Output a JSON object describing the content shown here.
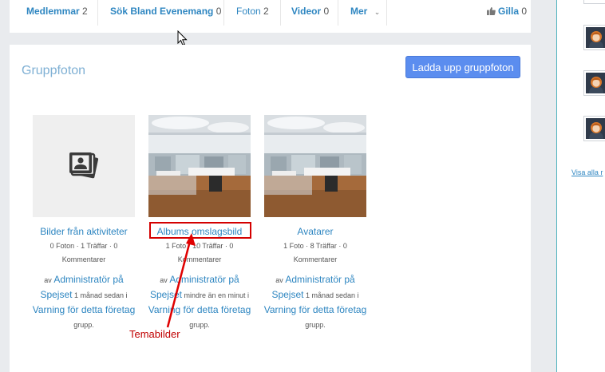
{
  "nav": {
    "items": [
      {
        "label": "Medlemmar",
        "count": "2"
      },
      {
        "label": "Sök Bland Evenemang",
        "count": "0"
      },
      {
        "label": "Foton",
        "count": "2"
      },
      {
        "label": "Videor",
        "count": "0"
      },
      {
        "label": "Mer",
        "count": ""
      }
    ],
    "like_label": "Gilla",
    "like_count": "0"
  },
  "section": {
    "title": "Gruppfoton",
    "upload_button": "Ladda upp gruppfoton"
  },
  "albums": [
    {
      "title": "Bilder från aktiviteter",
      "meta1": "0 Foton · 1 Träffar · 0",
      "meta2": "Kommentarer",
      "by_prefix": "av",
      "author": "Administratör på",
      "group_name": "Spejset",
      "time": "1 månad sedan i",
      "group_link": "Varning för detta företag",
      "suffix": "grupp."
    },
    {
      "title": "Albums omslagsbild",
      "meta1": "1 Foto · 10 Träffar · 0",
      "meta2": "Kommentarer",
      "by_prefix": "av",
      "author": "Administratör på",
      "group_name": "Spejset",
      "time": "mindre än en minut i",
      "group_link": "Varning för detta företag",
      "suffix": "grupp."
    },
    {
      "title": "Avatarer",
      "meta1": "1 Foto · 8 Träffar · 0",
      "meta2": "Kommentarer",
      "by_prefix": "av",
      "author": "Administratör på",
      "group_name": "Spejset",
      "time": "1 månad sedan i",
      "group_link": "Varning för detta företag",
      "suffix": "grupp."
    }
  ],
  "annotation": {
    "label": "Temabilder",
    "color": "#d40000"
  },
  "sidebar": {
    "see_all": "Visa alla r"
  },
  "colors": {
    "link": "#2e86c1",
    "button": "#5b8def",
    "page_bg": "#e9ebee"
  }
}
